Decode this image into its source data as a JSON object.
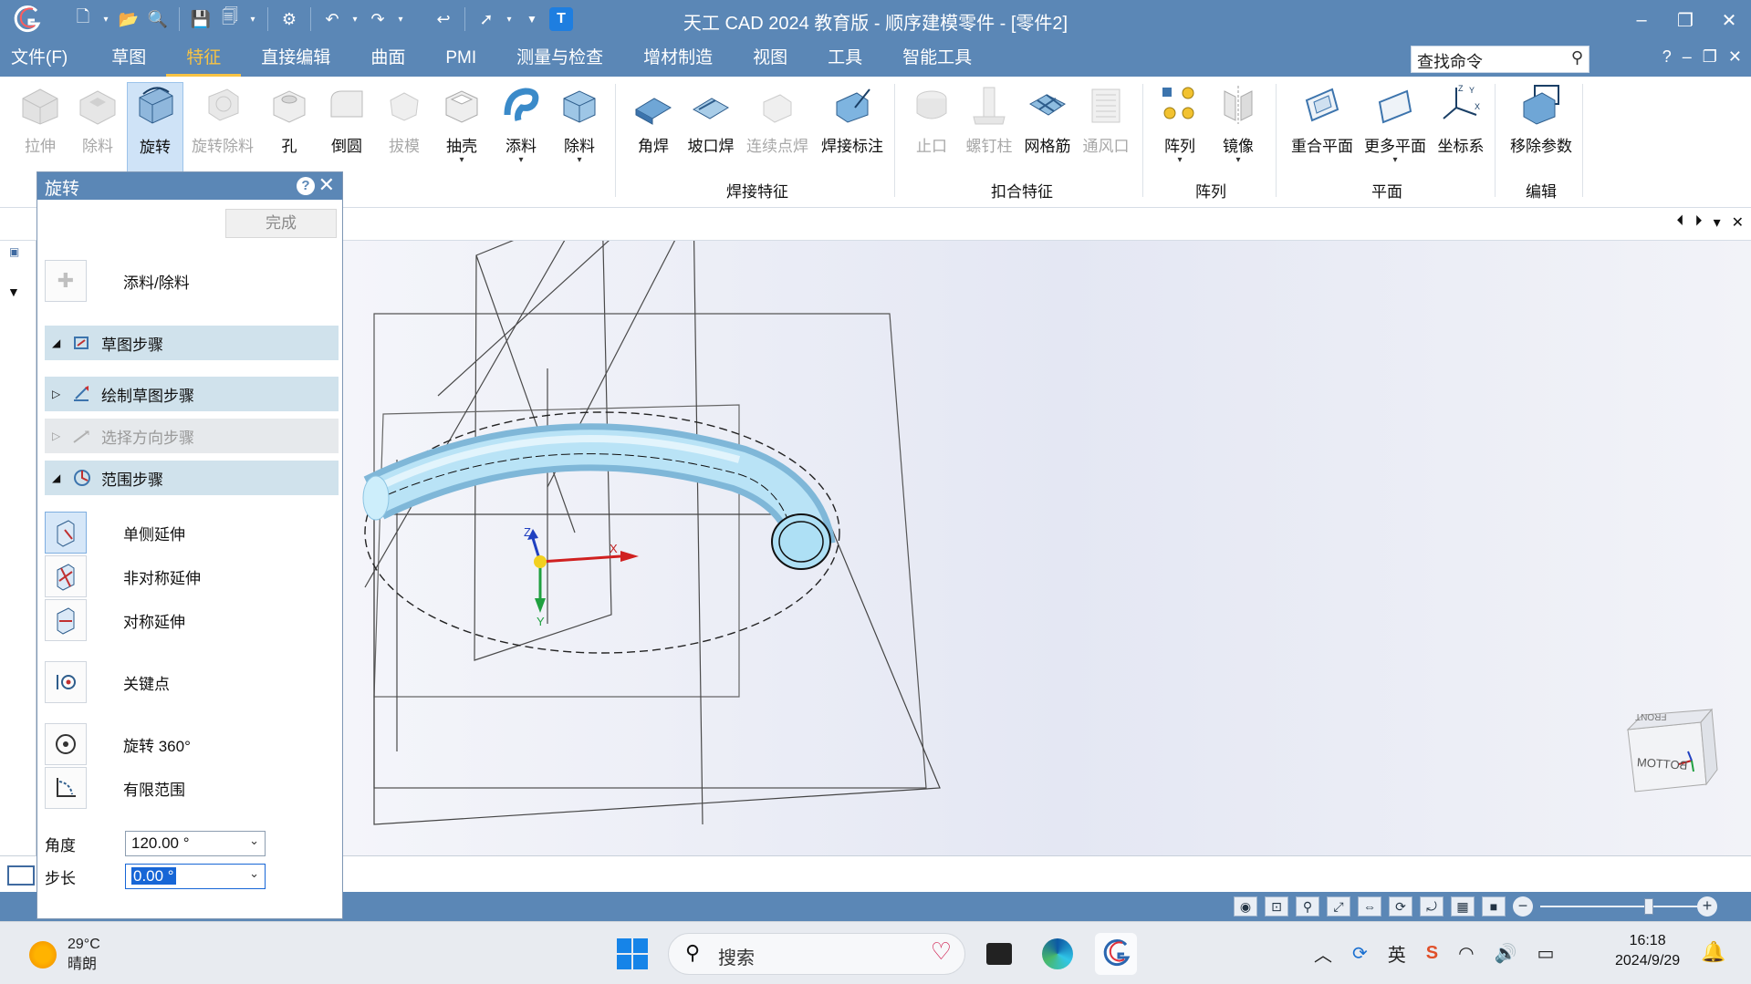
{
  "window": {
    "title": "天工 CAD 2024 教育版 - 顺序建模零件 - [零件2]",
    "controls": [
      "–",
      "❐",
      "✕"
    ]
  },
  "menu": {
    "items": [
      "文件(F)",
      "草图",
      "特征",
      "直接编辑",
      "曲面",
      "PMI",
      "测量与检查",
      "增材制造",
      "视图",
      "工具",
      "智能工具"
    ],
    "active": "特征",
    "search_placeholder": "查找命令",
    "right_icons": [
      "?",
      "–",
      "❐",
      "✕"
    ]
  },
  "ribbon": {
    "buttons": [
      {
        "label": "拉伸",
        "icon": "extrude-icon",
        "disabled": true
      },
      {
        "label": "除料",
        "icon": "cut-icon",
        "disabled": true
      },
      {
        "label": "旋转",
        "icon": "revolve-icon",
        "disabled": false,
        "active": true
      },
      {
        "label": "旋转除料",
        "icon": "revolve-cut-icon",
        "disabled": true
      },
      {
        "label": "孔",
        "icon": "hole-icon",
        "disabled": false
      },
      {
        "label": "倒圆",
        "icon": "round-icon",
        "disabled": false
      },
      {
        "label": "拔模",
        "icon": "draft-icon",
        "disabled": true
      },
      {
        "label": "抽壳",
        "icon": "shell-icon",
        "disabled": false
      },
      {
        "label": "添料",
        "icon": "add-material-icon",
        "disabled": false
      },
      {
        "label": "除料",
        "icon": "remove-material-icon",
        "disabled": false
      },
      {
        "label": "角焊",
        "icon": "fillet-weld-icon",
        "disabled": false
      },
      {
        "label": "坡口焊",
        "icon": "groove-weld-icon",
        "disabled": false
      },
      {
        "label": "连续点焊",
        "icon": "spot-weld-icon",
        "disabled": true
      },
      {
        "label": "焊接标注",
        "icon": "weld-annotation-icon",
        "disabled": false
      },
      {
        "label": "止口",
        "icon": "lip-icon",
        "disabled": true
      },
      {
        "label": "螺钉柱",
        "icon": "boss-icon",
        "disabled": true
      },
      {
        "label": "网格筋",
        "icon": "web-network-icon",
        "disabled": false
      },
      {
        "label": "通风口",
        "icon": "vent-icon",
        "disabled": true
      },
      {
        "label": "阵列",
        "icon": "pattern-icon",
        "disabled": false
      },
      {
        "label": "镜像",
        "icon": "mirror-icon",
        "disabled": false
      },
      {
        "label": "重合平面",
        "icon": "coincident-plane-icon",
        "disabled": false
      },
      {
        "label": "更多平面",
        "icon": "more-planes-icon",
        "disabled": false
      },
      {
        "label": "坐标系",
        "icon": "coordinate-system-icon",
        "disabled": false
      },
      {
        "label": "移除参数",
        "icon": "remove-parameters-icon",
        "disabled": false
      }
    ],
    "groups": [
      "焊接特征",
      "扣合特征",
      "阵列",
      "平面",
      "编辑"
    ]
  },
  "dialog": {
    "title": "旋转",
    "done": "完成",
    "add_remove": "添料/除料",
    "sections": [
      "草图步骤",
      "绘制草图步骤",
      "选择方向步骤",
      "范围步骤"
    ],
    "options": [
      "单侧延伸",
      "非对称延伸",
      "对称延伸",
      "关键点",
      "旋转 360°",
      "有限范围"
    ],
    "angle_label": "角度",
    "angle_value": "120.00 °",
    "step_label": "步长",
    "step_value": "0.00 °"
  },
  "viewport": {
    "triad": {
      "x": "X",
      "y": "Y",
      "z": "Z"
    },
    "viewcube": {
      "front": "FRONT",
      "bottom": "BOTTOM"
    }
  },
  "taskbar": {
    "temp": "29°C",
    "weather": "晴朗",
    "search": "搜索",
    "ime": "英",
    "time": "16:18",
    "date": "2024/9/29"
  },
  "colors": {
    "chrome": "#5b87b6",
    "active_menu": "#f7c344",
    "tube": "#a9dcf2"
  }
}
